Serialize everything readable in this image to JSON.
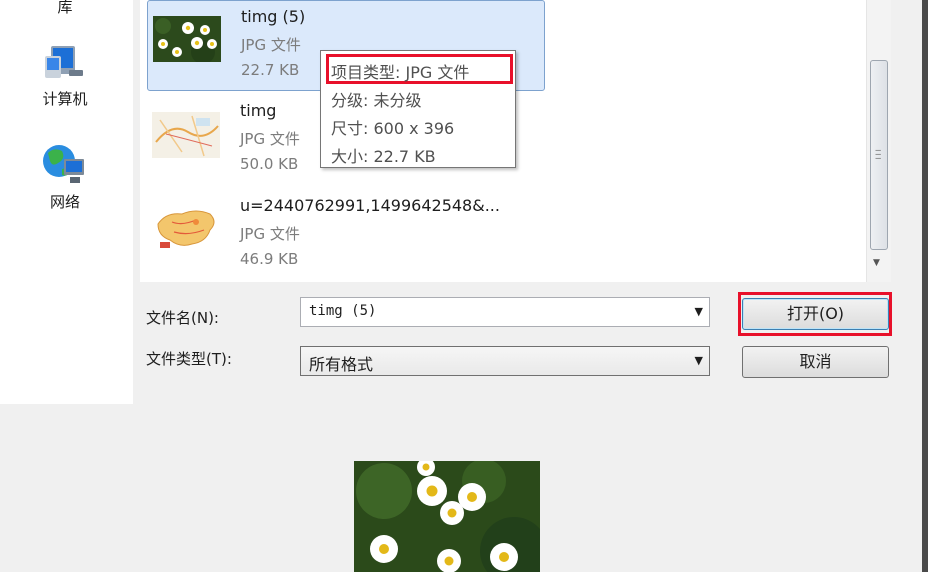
{
  "nav": {
    "items": [
      {
        "label": "库",
        "icon": "library-icon"
      },
      {
        "label": "计算机",
        "icon": "computer-icon"
      },
      {
        "label": "网络",
        "icon": "network-icon"
      }
    ]
  },
  "files": [
    {
      "name": "timg (5)",
      "type": "JPG 文件",
      "size": "22.7 KB",
      "selected": true
    },
    {
      "name": "timg",
      "type": "JPG 文件",
      "size": "50.0 KB",
      "selected": false
    },
    {
      "name": "u=2440762991,1499642548&...",
      "type": "JPG 文件",
      "size": "46.9 KB",
      "selected": false
    }
  ],
  "tooltip": {
    "item_type": "项目类型: JPG 文件",
    "rating": "分级: 未分级",
    "dimensions": "尺寸: 600 x 396",
    "size": "大小: 22.7 KB"
  },
  "form": {
    "filename_label": "文件名(N):",
    "filename_value": "timg (5)",
    "filetype_label": "文件类型(T):",
    "filetype_value": "所有格式"
  },
  "buttons": {
    "open_label": "打开(O)",
    "cancel_label": "取消"
  },
  "colors": {
    "selection": "#dbe9fb",
    "highlight": "#e8102a"
  }
}
